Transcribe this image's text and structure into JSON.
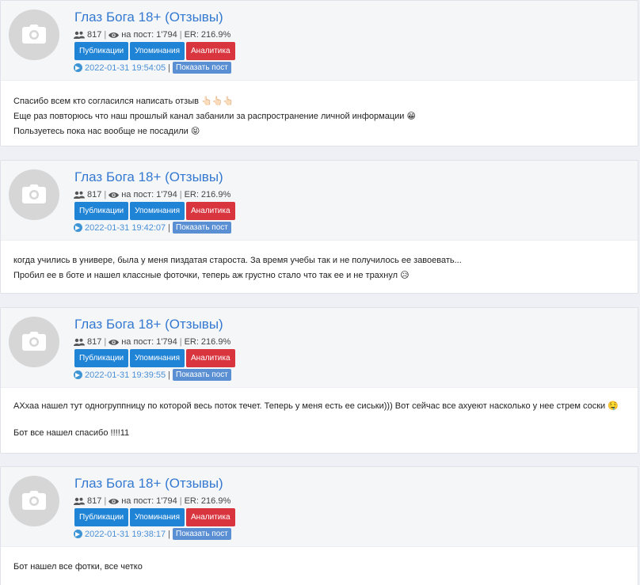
{
  "ui": {
    "buttons": {
      "publications": "Публикации",
      "mentions": "Упоминания",
      "analytics": "Аналитика",
      "show_post": "Показать пост"
    },
    "stats_labels": {
      "views_prefix": "на пост:",
      "er_prefix": "ER:"
    },
    "icons": {
      "avatar": "camera-icon",
      "subscribers": "users-icon",
      "views": "eye-icon",
      "source": "telegram-icon"
    },
    "colors": {
      "title": "#3479d1",
      "button_blue": "#1f83d6",
      "button_red": "#d9353f",
      "show_post": "#5b8fd3"
    }
  },
  "posts": [
    {
      "channel": "Глаз Бога 18+ (Отзывы)",
      "subscribers": "817",
      "views": "1'794",
      "er": "216.9%",
      "datetime": "2022-01-31 19:54:05",
      "lines": [
        "Спасибо всем кто согласился написать отзыв 👆🏻👆🏻👆🏻",
        "Еще раз повторюсь что наш прошлый канал забанили за распространение личной информации 😁",
        "Пользуетесь пока нас вообще не посадили 😝"
      ]
    },
    {
      "channel": "Глаз Бога 18+ (Отзывы)",
      "subscribers": "817",
      "views": "1'794",
      "er": "216.9%",
      "datetime": "2022-01-31 19:42:07",
      "lines": [
        "когда учились в универе, была у меня пиздатая староста. За время учебы так и не получилось ее завоевать...",
        "Пробил ее в боте и нашел классные фоточки, теперь аж грустно стало что так ее и не трахнул 😥"
      ]
    },
    {
      "channel": "Глаз Бога 18+ (Отзывы)",
      "subscribers": "817",
      "views": "1'794",
      "er": "216.9%",
      "datetime": "2022-01-31 19:39:55",
      "lines": [
        "АХхаа нашел тут одногруппницу по которой весь поток течет. Теперь у меня есть ее сиськи))) Вот сейчас все ахуеют насколько у нее стрем соски 🤤",
        "",
        "Бот все нашел спасибо !!!!11"
      ]
    },
    {
      "channel": "Глаз Бога 18+ (Отзывы)",
      "subscribers": "817",
      "views": "1'794",
      "er": "216.9%",
      "datetime": "2022-01-31 19:38:17",
      "lines": [
        "Бот нашел все фотки, все четко"
      ]
    }
  ]
}
